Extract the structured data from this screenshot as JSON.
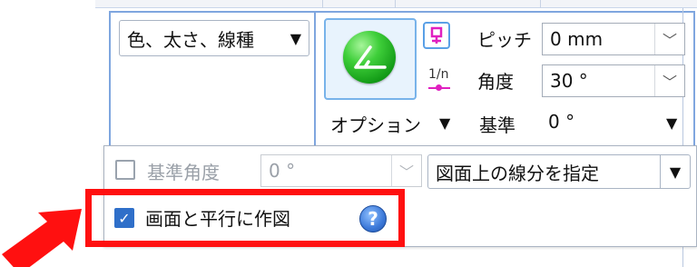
{
  "line_style_dropdown": {
    "label": "色、太さ、線種"
  },
  "option_button": {
    "label": "オプション"
  },
  "fraction_label": "1/n",
  "pitch": {
    "label": "ピッチ",
    "value": "0 mm"
  },
  "angle": {
    "label": "角度",
    "value": "30 °"
  },
  "base": {
    "label": "基準",
    "value": "0 °"
  },
  "base_angle": {
    "label": "基準角度",
    "value": "0 °",
    "checked": false
  },
  "specify_segment": {
    "label": "図面上の線分を指定"
  },
  "parallel_to_screen": {
    "label": "画面と平行に作図",
    "checked": true
  },
  "help": {
    "symbol": "?"
  },
  "colors": {
    "highlight": "#ff1010",
    "accent": "#2f6fc9",
    "group_border": "#7fa6df"
  },
  "icons": [
    "caret-down-icon",
    "green-ball-icon",
    "dimension-icon",
    "help-icon",
    "red-arrow-icon"
  ]
}
